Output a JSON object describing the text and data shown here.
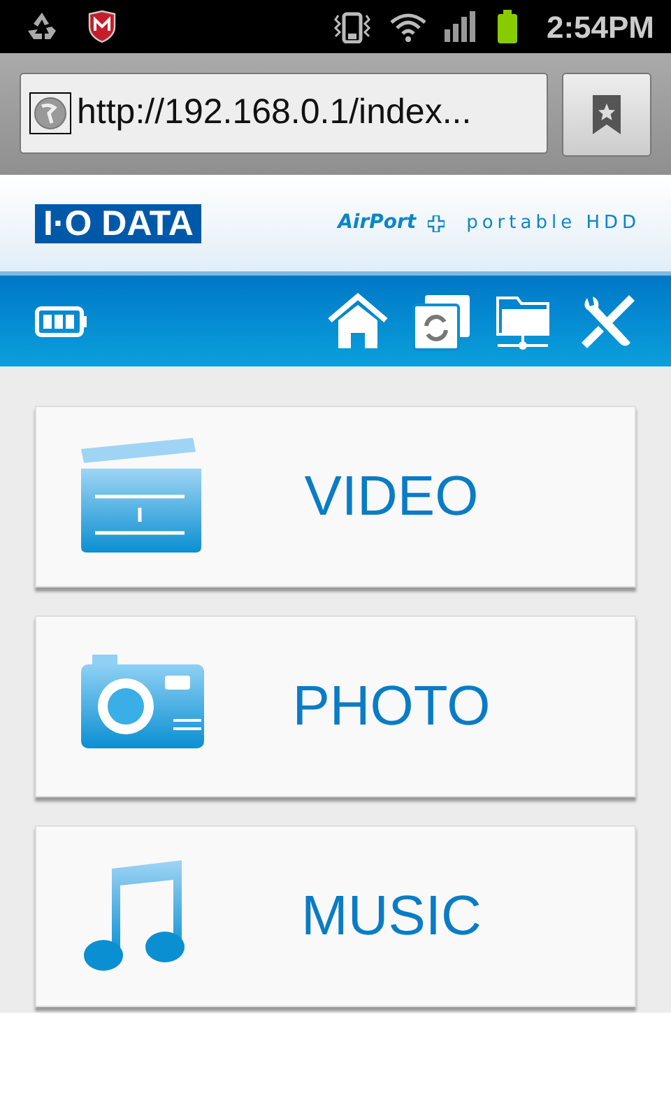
{
  "status_bar": {
    "time": "2:54PM"
  },
  "browser": {
    "url": "http://192.168.0.1/index..."
  },
  "header": {
    "logo": "I·O DATA",
    "brand": "AirPort",
    "product": "portable HDD"
  },
  "menu": [
    {
      "kind": "video",
      "label": "VIDEO"
    },
    {
      "kind": "photo",
      "label": "PHOTO"
    },
    {
      "kind": "music",
      "label": "MUSIC"
    }
  ]
}
